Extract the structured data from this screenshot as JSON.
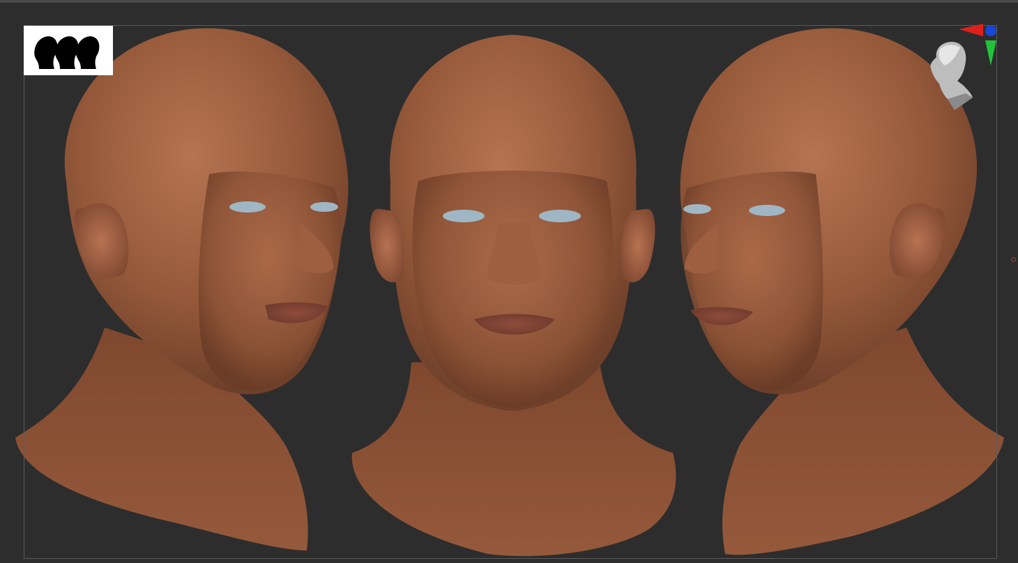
{
  "viewport": {
    "background_color": "#2d2d2d",
    "frame_color": "#5b5b5b",
    "skin_color": "#9a5c3c",
    "eye_color": "#9fb6c4"
  },
  "model": {
    "views": [
      "three-quarter-left",
      "front",
      "three-quarter-right"
    ]
  },
  "thumbnail": {
    "icon": "three-heads-icon",
    "background_color": "#ffffff",
    "silhouette_color": "#000000"
  },
  "gizmo": {
    "icon": "head-orientation-gizmo-icon",
    "axis_colors": {
      "x": "#e0201c",
      "y": "#22c33a",
      "z": "#1846d8"
    }
  }
}
